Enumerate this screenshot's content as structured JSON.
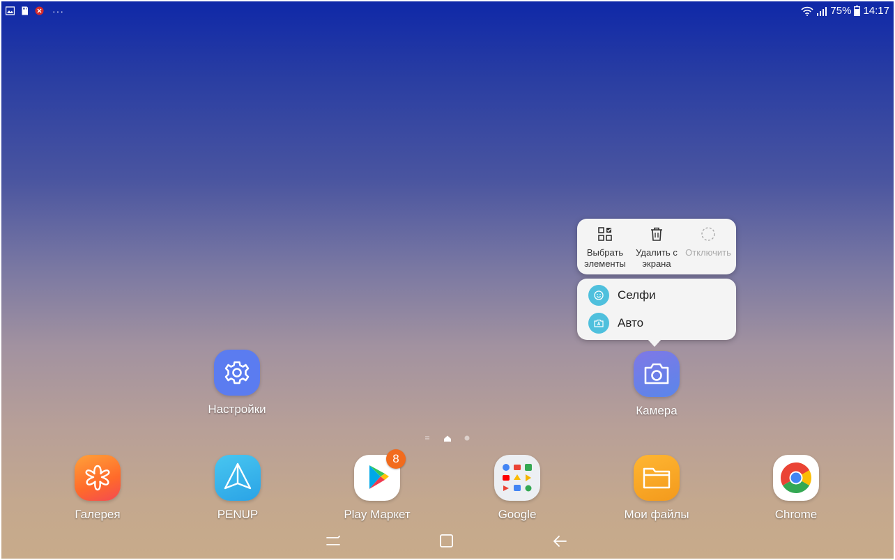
{
  "status_bar": {
    "notification_icons": [
      "gallery-icon",
      "sd-card-icon",
      "red-app-icon",
      "more-notifications-icon"
    ],
    "more_dots": "···",
    "battery_percent": "75%",
    "time": "14:17"
  },
  "home_apps": [
    {
      "name": "Настройки",
      "icon": "settings-gear-icon"
    },
    {
      "name": "Камера",
      "icon": "camera-icon"
    }
  ],
  "popup": {
    "actions": [
      {
        "label_line1": "Выбрать",
        "label_line2": "элементы",
        "icon": "select-items-icon",
        "enabled": true
      },
      {
        "label_line1": "Удалить с",
        "label_line2": "экрана",
        "icon": "trash-icon",
        "enabled": true
      },
      {
        "label_line1": "Отключить",
        "label_line2": "",
        "icon": "disable-icon",
        "enabled": false
      }
    ],
    "shortcuts": [
      {
        "label": "Селфи",
        "icon": "selfie-icon"
      },
      {
        "label": "Авто",
        "icon": "auto-mode-icon"
      }
    ],
    "accent_color": "#4fc0dd"
  },
  "dock": [
    {
      "name": "Галерея",
      "icon": "gallery-flower-icon"
    },
    {
      "name": "PENUP",
      "icon": "penup-icon"
    },
    {
      "name": "Play Маркет",
      "icon": "play-store-icon",
      "badge": "8"
    },
    {
      "name": "Google",
      "icon": "google-folder-icon"
    },
    {
      "name": "Мои файлы",
      "icon": "my-files-folder-icon"
    },
    {
      "name": "Chrome",
      "icon": "chrome-icon"
    }
  ],
  "page_indicator": {
    "pages": 2,
    "current": "home"
  },
  "nav_bar": [
    "recent-apps-button",
    "home-button",
    "back-button"
  ],
  "colors": {
    "badge": "#f26b1d",
    "settings_tile": "#5b7cf0",
    "camera_tile": "#6a7ce8",
    "gallery_tile": "#ff8a2a",
    "penup_tile": "#34b4e8",
    "files_tile": "#f6a623"
  }
}
